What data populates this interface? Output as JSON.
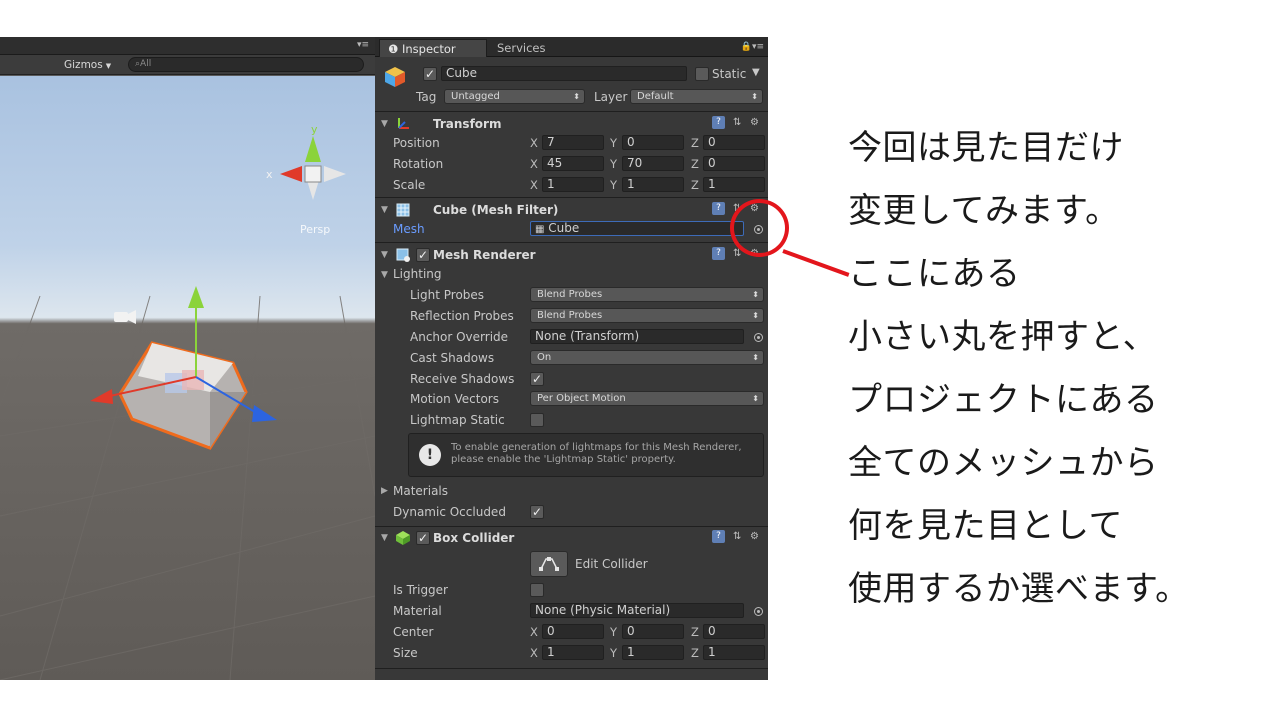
{
  "scene": {
    "gizmos_label": "Gizmos",
    "search_placeholder": "All",
    "persp_label": "Persp",
    "axis_x": "x",
    "axis_y": "y"
  },
  "inspector": {
    "tabs": [
      "Inspector",
      "Services"
    ],
    "object": {
      "name": "Cube",
      "enabled": true,
      "static_label": "Static",
      "tag_label": "Tag",
      "tag_value": "Untagged",
      "layer_label": "Layer",
      "layer_value": "Default"
    },
    "transform": {
      "title": "Transform",
      "rows": [
        {
          "label": "Position",
          "x": "7",
          "y": "0",
          "z": "0"
        },
        {
          "label": "Rotation",
          "x": "45",
          "y": "70",
          "z": "0"
        },
        {
          "label": "Scale",
          "x": "1",
          "y": "1",
          "z": "1"
        }
      ]
    },
    "mesh_filter": {
      "title": "Cube (Mesh Filter)",
      "mesh_label": "Mesh",
      "mesh_value": "Cube"
    },
    "mesh_renderer": {
      "title": "Mesh Renderer",
      "lighting_label": "Lighting",
      "light_probes_label": "Light Probes",
      "light_probes_value": "Blend Probes",
      "reflection_probes_label": "Reflection Probes",
      "reflection_probes_value": "Blend Probes",
      "anchor_override_label": "Anchor Override",
      "anchor_override_value": "None (Transform)",
      "cast_shadows_label": "Cast Shadows",
      "cast_shadows_value": "On",
      "receive_shadows_label": "Receive Shadows",
      "receive_shadows": true,
      "motion_vectors_label": "Motion Vectors",
      "motion_vectors_value": "Per Object Motion",
      "lightmap_static_label": "Lightmap Static",
      "lightmap_static": false,
      "help_line1": "To enable generation of lightmaps for this Mesh Renderer,",
      "help_line2": "please enable the 'Lightmap Static' property.",
      "materials_label": "Materials",
      "dynamic_occluded_label": "Dynamic Occluded",
      "dynamic_occluded": true
    },
    "box_collider": {
      "title": "Box Collider",
      "edit_collider_label": "Edit Collider",
      "is_trigger_label": "Is Trigger",
      "is_trigger": false,
      "material_label": "Material",
      "material_value": "None (Physic Material)",
      "center": {
        "label": "Center",
        "x": "0",
        "y": "0",
        "z": "0"
      },
      "size": {
        "label": "Size",
        "x": "1",
        "y": "1",
        "z": "1"
      }
    },
    "axis_labels": {
      "x": "X",
      "y": "Y",
      "z": "Z"
    }
  },
  "annotation": {
    "lines": [
      "今回は見た目だけ",
      "変更してみます。",
      "ここにある",
      "小さい丸を押すと、",
      "プロジェクトにある",
      "全てのメッシュから",
      "何を見た目として",
      "使用するか選べます。"
    ],
    "highlight_color": "#e3161c"
  }
}
